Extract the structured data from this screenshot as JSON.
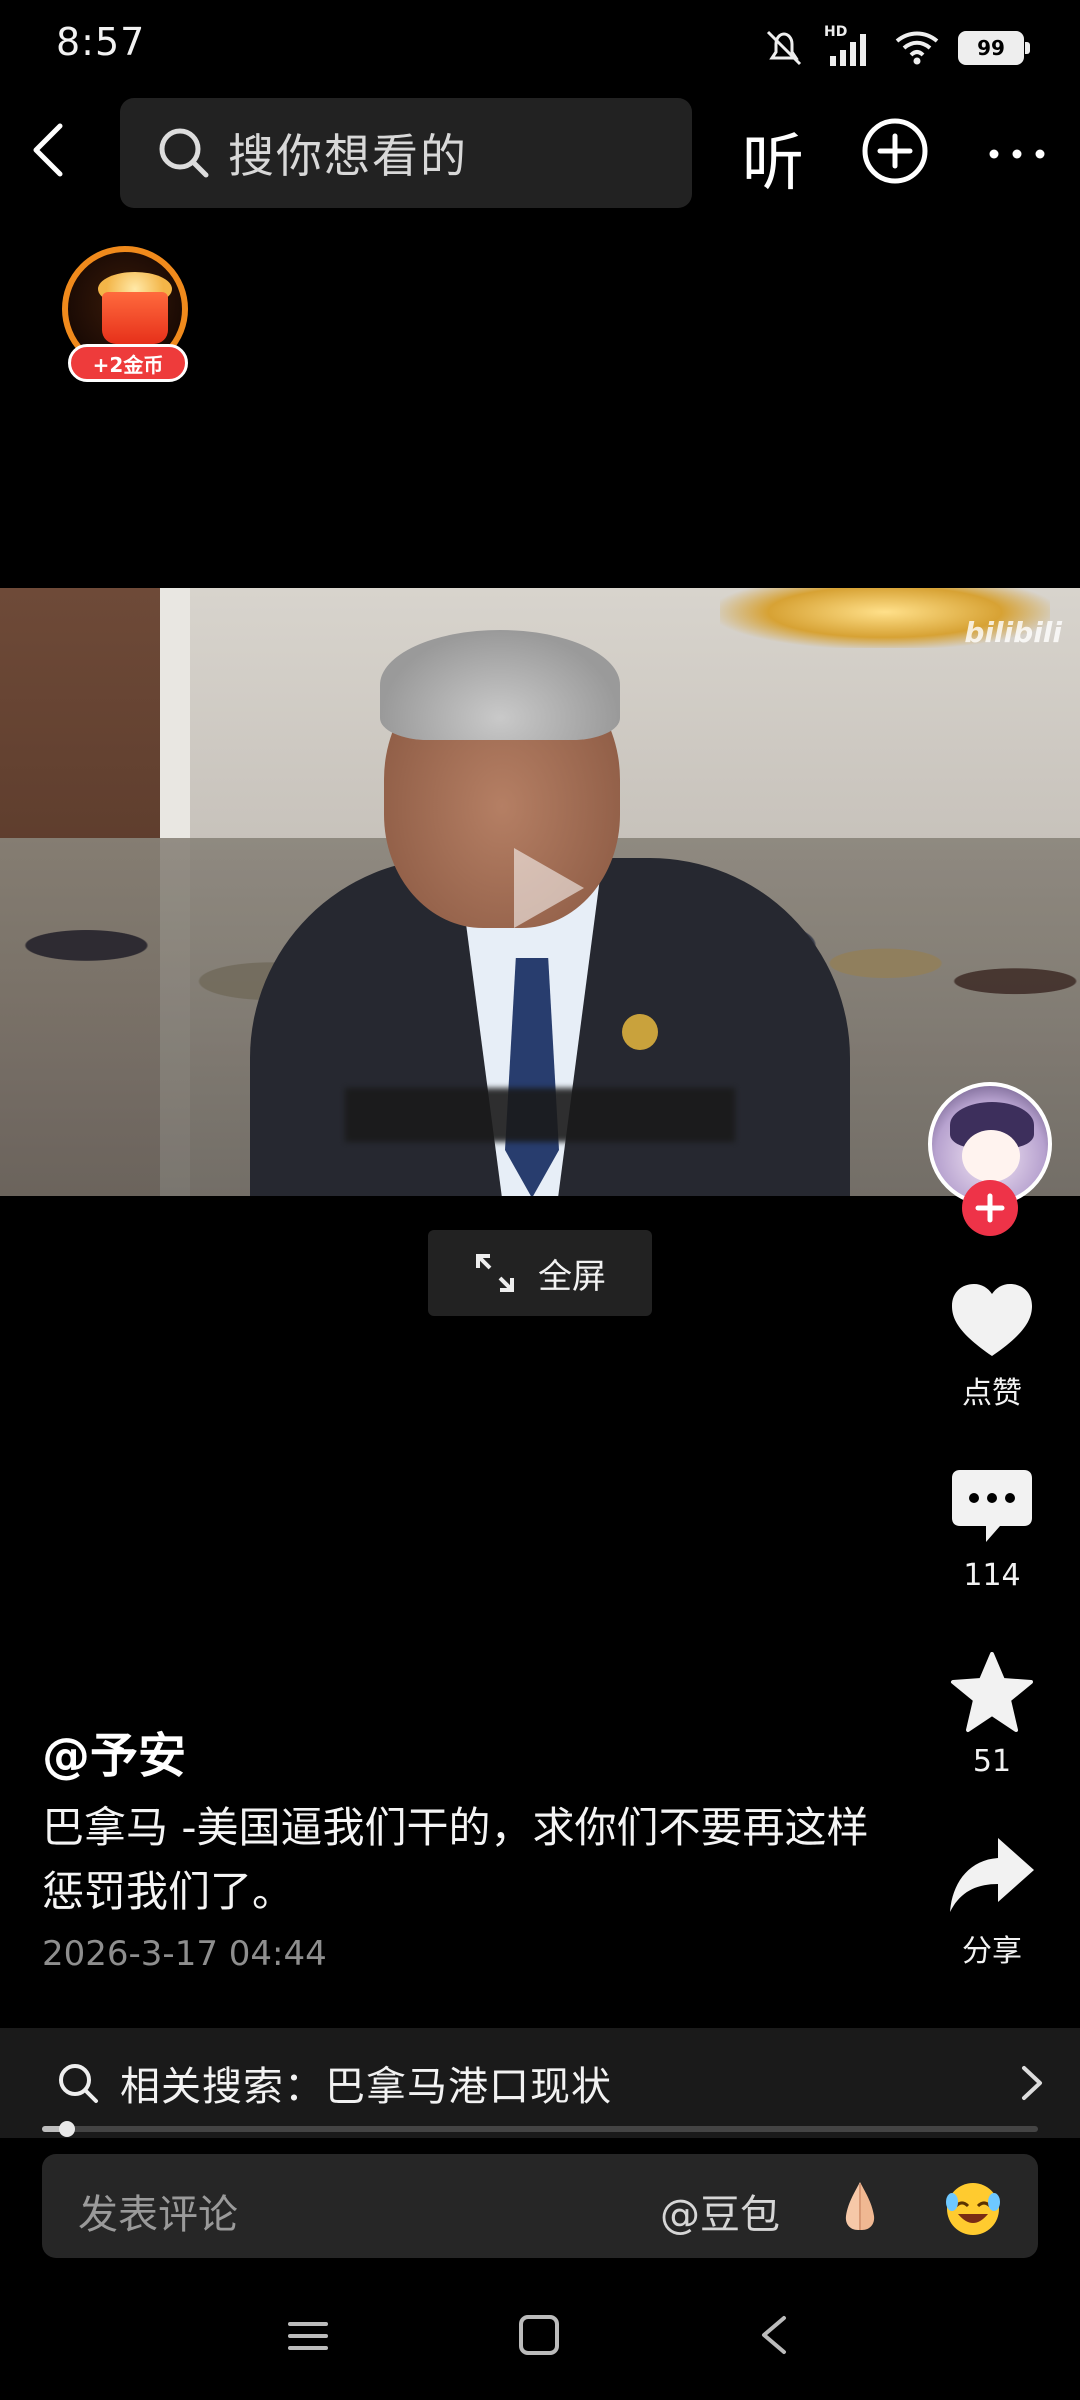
{
  "status_bar": {
    "time": "8:57",
    "network_badge": "HD",
    "battery": "99"
  },
  "top_bar": {
    "search_placeholder": "搜你想看的",
    "listen_label": "听"
  },
  "coin_badge": {
    "label": "+2金币"
  },
  "video": {
    "watermark": "bilibili",
    "fullscreen_label": "全屏"
  },
  "actions": {
    "like_label": "点赞",
    "comment_count": "114",
    "favorite_count": "51",
    "share_label": "分享"
  },
  "post": {
    "author": "@予安",
    "description": "巴拿马 -美国逼我们干的，求你们不要再这样惩罚我们了。",
    "time": "2026-3-17 04:44"
  },
  "related_search": {
    "label": "相关搜索：巴拿马港口现状"
  },
  "playback": {
    "progress": 0.025
  },
  "comment_bar": {
    "placeholder": "发表评论",
    "mention": "@豆包"
  },
  "icons": {
    "back": "chevron-left-icon",
    "search": "search-icon",
    "add": "plus-circle-icon",
    "more": "more-horizontal-icon",
    "like": "heart-icon",
    "comment": "comment-bubble-icon",
    "favorite": "star-icon",
    "share": "share-arrow-icon",
    "fullscreen": "expand-icon"
  },
  "colors": {
    "accent_red": "#ee3348",
    "coin_orange": "#f08a1c",
    "background": "#000000"
  }
}
